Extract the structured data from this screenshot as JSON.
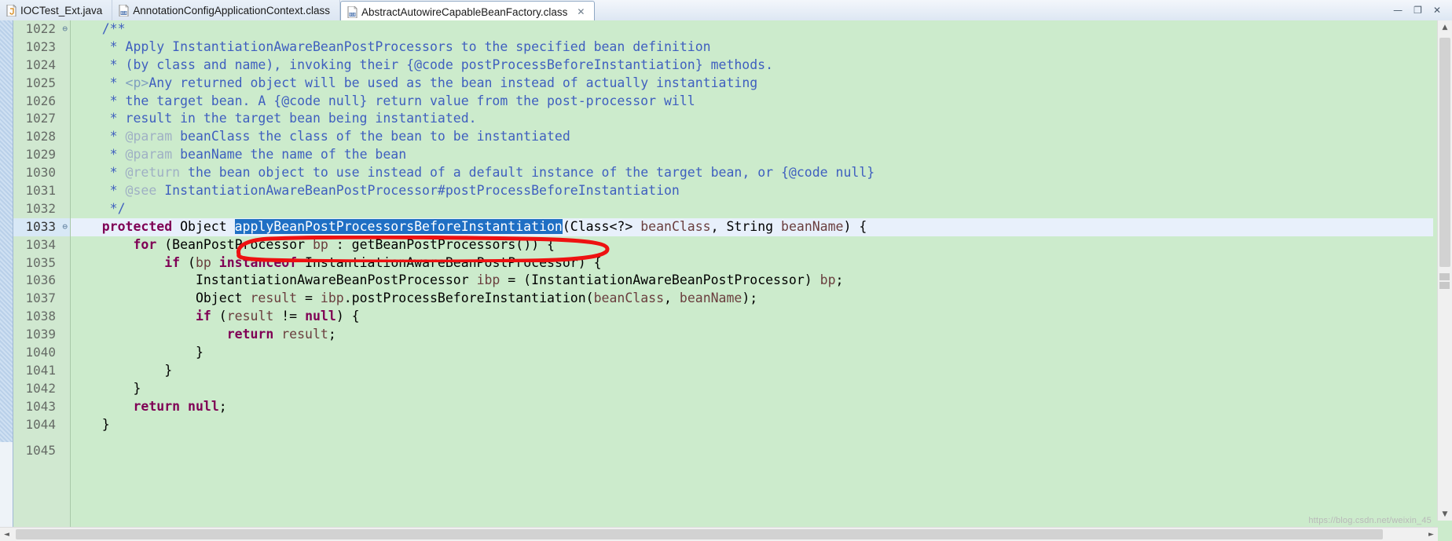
{
  "window": {
    "controls": [
      "minimize",
      "maximize",
      "close"
    ],
    "minimize_glyph": "—",
    "maximize_glyph": "❐",
    "close_glyph": "✕"
  },
  "tabs": [
    {
      "label": "IOCTest_Ext.java",
      "icon": "java-file-icon",
      "active": false,
      "closable": false
    },
    {
      "label": "AnnotationConfigApplicationContext.class",
      "icon": "class-file-icon",
      "active": false,
      "closable": false
    },
    {
      "label": "AbstractAutowireCapableBeanFactory.class",
      "icon": "class-file-icon",
      "active": true,
      "closable": true,
      "close_glyph": "✕"
    }
  ],
  "editor": {
    "current_line_number": 1033,
    "selection": "applyBeanPostProcessorsBeforeInstantiation",
    "colors": {
      "background": "#ccebcc",
      "gutter_background": "#d0e8d0",
      "current_line": "#e8f0fb",
      "selection": "#1f6fc4",
      "javadoc": "#3f5fbf",
      "javadoc_tag": "#9fb0c4",
      "keyword": "#7f0055",
      "parameter": "#6a3e3e",
      "annotation_oval": "#ee1111"
    },
    "gutter": [
      {
        "n": "1022",
        "fold": true
      },
      {
        "n": "1023",
        "fold": false
      },
      {
        "n": "1024",
        "fold": false
      },
      {
        "n": "1025",
        "fold": false
      },
      {
        "n": "1026",
        "fold": false
      },
      {
        "n": "1027",
        "fold": false
      },
      {
        "n": "1028",
        "fold": false
      },
      {
        "n": "1029",
        "fold": false
      },
      {
        "n": "1030",
        "fold": false
      },
      {
        "n": "1031",
        "fold": false
      },
      {
        "n": "1032",
        "fold": false
      },
      {
        "n": "1033",
        "fold": true
      },
      {
        "n": "1034",
        "fold": false
      },
      {
        "n": "1035",
        "fold": false
      },
      {
        "n": "1036",
        "fold": false
      },
      {
        "n": "1037",
        "fold": false
      },
      {
        "n": "1038",
        "fold": false
      },
      {
        "n": "1039",
        "fold": false
      },
      {
        "n": "1040",
        "fold": false
      },
      {
        "n": "1041",
        "fold": false
      },
      {
        "n": "1042",
        "fold": false
      },
      {
        "n": "1043",
        "fold": false
      },
      {
        "n": "1044",
        "fold": false
      }
    ],
    "last_gutter_line": "1045",
    "code_lines": [
      "    /**",
      "     * Apply InstantiationAwareBeanPostProcessors to the specified bean definition",
      "     * (by class and name), invoking their {@code postProcessBeforeInstantiation} methods.",
      "     * <p>Any returned object will be used as the bean instead of actually instantiating",
      "     * the target bean. A {@code null} return value from the post-processor will",
      "     * result in the target bean being instantiated.",
      "     * @param beanClass the class of the bean to be instantiated",
      "     * @param beanName the name of the bean",
      "     * @return the bean object to use instead of a default instance of the target bean, or {@code null}",
      "     * @see InstantiationAwareBeanPostProcessor#postProcessBeforeInstantiation",
      "     */",
      "    protected Object applyBeanPostProcessorsBeforeInstantiation(Class<?> beanClass, String beanName) {",
      "        for (BeanPostProcessor bp : getBeanPostProcessors()) {",
      "            if (bp instanceof InstantiationAwareBeanPostProcessor) {",
      "                InstantiationAwareBeanPostProcessor ibp = (InstantiationAwareBeanPostProcessor) bp;",
      "                Object result = ibp.postProcessBeforeInstantiation(beanClass, beanName);",
      "                if (result != null) {",
      "                    return result;",
      "                }",
      "            }",
      "        }",
      "        return null;",
      "    }"
    ]
  },
  "scrollbars": {
    "vertical": {
      "up_glyph": "▲",
      "down_glyph": "▼"
    },
    "horizontal": {
      "left_glyph": "◄",
      "right_glyph": "►"
    }
  },
  "watermark": "https://blog.csdn.net/weixin_45"
}
